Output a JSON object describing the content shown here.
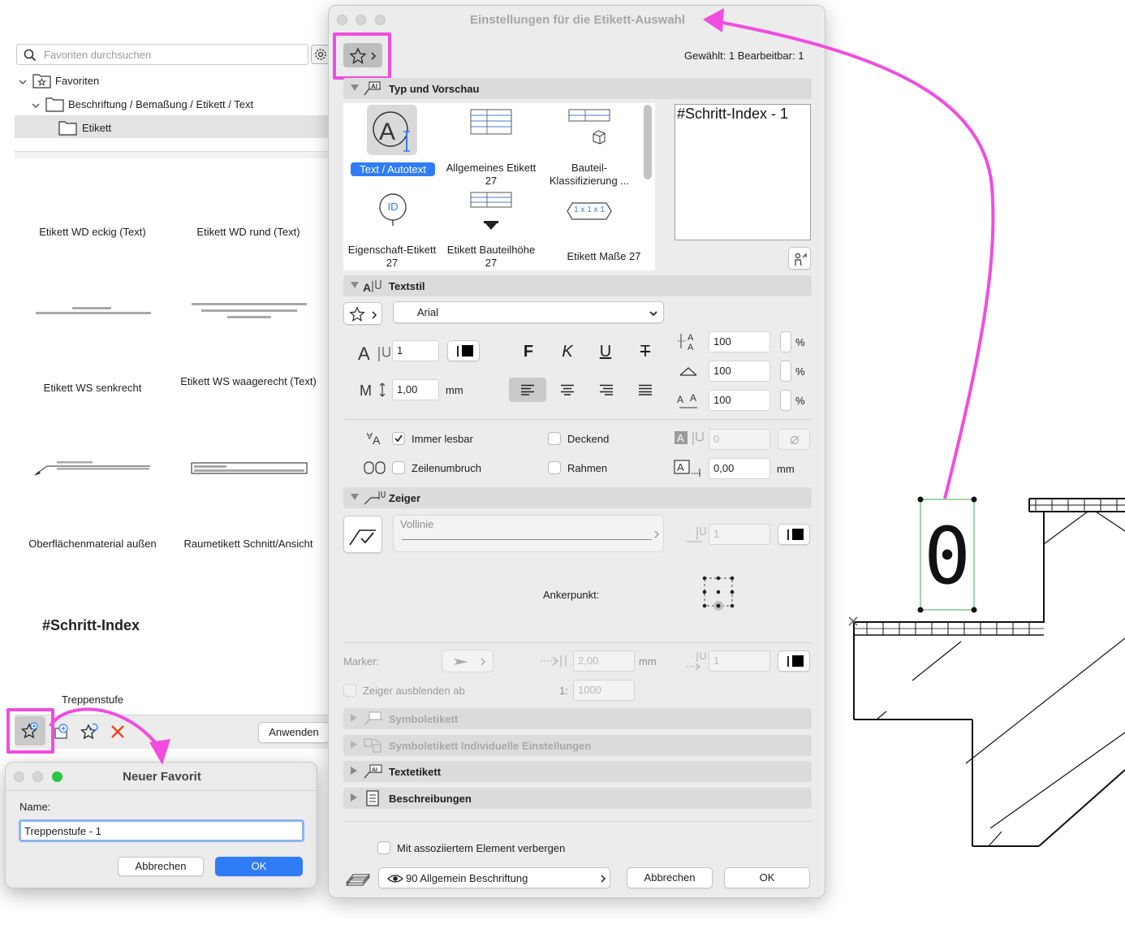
{
  "favorites": {
    "search_placeholder": "Favoriten durchsuchen",
    "tree": [
      {
        "label": "Favoriten"
      },
      {
        "label": "Beschriftung / Bemaßung / Etikett / Text"
      },
      {
        "label": "Etikett"
      }
    ],
    "items": [
      {
        "label": "Etikett WD eckig (Text)"
      },
      {
        "label": "Etikett WD rund (Text)"
      },
      {
        "label": "Etikett WS senkrecht"
      },
      {
        "label": "Etikett WS waagerecht (Text)"
      },
      {
        "label": "Oberflächenmaterial außen"
      },
      {
        "label": "Raumetikett Schnitt/Ansicht"
      },
      {
        "label": "Treppenstufe",
        "preview": "#Schritt-Index"
      }
    ],
    "apply_label": "Anwenden"
  },
  "new_favorite": {
    "title": "Neuer Favorit",
    "name_label": "Name:",
    "name_value": "Treppenstufe - 1",
    "cancel_label": "Abbrechen",
    "ok_label": "OK"
  },
  "settings": {
    "title": "Einstellungen für die Etikett-Auswahl",
    "selection_status": "Gewählt: 1 Bearbeitbar: 1",
    "sections": {
      "typ": "Typ und Vorschau",
      "textstil": "Textstil",
      "zeiger": "Zeiger",
      "symboletikett": "Symboletikett",
      "symboletikett_ind": "Symboletikett Individuelle Einstellungen",
      "textetikett": "Textetikett",
      "beschreibungen": "Beschreibungen"
    },
    "gallery": [
      {
        "label": "Text / Autotext"
      },
      {
        "label": "Allgemeines Etikett 27"
      },
      {
        "label": "Bauteil-Klassifizierung ..."
      },
      {
        "label": "Eigenschaft-Etikett 27"
      },
      {
        "label": "Etikett Bauteilhöhe 27"
      },
      {
        "label": "Etikett Maße 27"
      }
    ],
    "gallery_icons": {
      "id_badge": "ID",
      "size_badge": "1 x 1 x 1"
    },
    "preview_text": "#Schritt-Index - 1",
    "textstil": {
      "font": "Arial",
      "size": "1",
      "spacing": "1,00",
      "unit_mm": "mm",
      "bold": "F",
      "italic": "K",
      "underline": "U",
      "strike": "T",
      "pct1": "100",
      "pct2": "100",
      "pct3": "100",
      "pct_unit": "%",
      "immer_lesbar": "Immer lesbar",
      "zeilenumbruch": "Zeilenumbruch",
      "deckend": "Deckend",
      "rahmen": "Rahmen",
      "bg_value": "0",
      "frame_offset": "0,00"
    },
    "zeiger": {
      "line_type": "Vollinie",
      "pen": "1",
      "anchor_label": "Ankerpunkt:",
      "marker_label": "Marker:",
      "marker_size": "2,00",
      "marker_pen": "1",
      "hide_label": "Zeiger ausblenden ab",
      "hide_ratio": "1:",
      "hide_scale": "1000"
    },
    "hide_with_element": "Mit assoziiertem Element verbergen",
    "layer": "90 Allgemein Beschriftung",
    "cancel_label": "Abbrechen",
    "ok_label": "OK"
  },
  "drawing": {
    "stair_number": "0"
  },
  "colors": {
    "annotation": "#f04de0",
    "accent": "#2f7cf6"
  }
}
